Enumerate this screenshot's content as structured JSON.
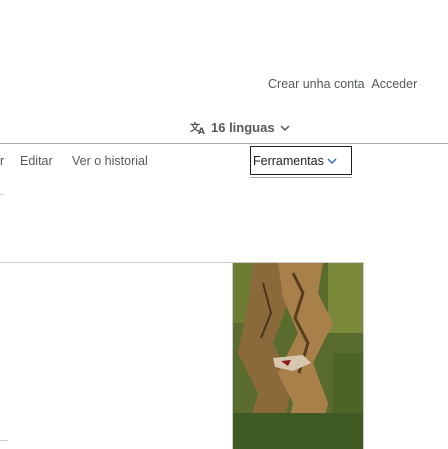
{
  "user_links": {
    "create_account": "Crear unha conta",
    "login": "Acceder"
  },
  "language_button": {
    "icon": "translate-icon",
    "label": "16 linguas",
    "chevron": "chevron-down-icon"
  },
  "tabs": {
    "read_partial": "r",
    "edit": "Editar",
    "history": "Ver o historial",
    "tools": "Ferramentas"
  },
  "image": {
    "subject": "tree-trunk-photo"
  }
}
